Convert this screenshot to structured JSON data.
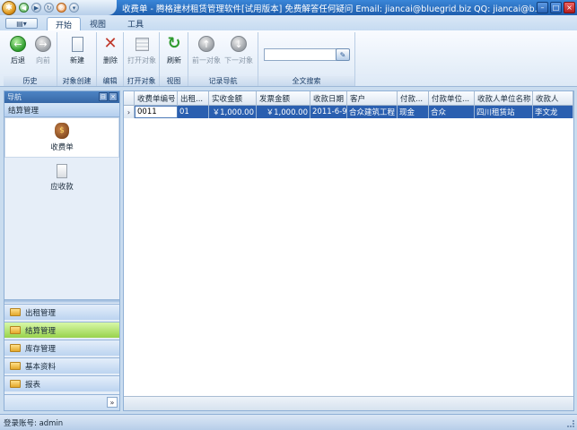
{
  "window": {
    "title": "收费单 - 腾格建材租赁管理软件[试用版本] 免费解答任何疑问 Email: jiancai@bluegrid.biz QQ: jiancai@b...",
    "minimize": "–",
    "maximize": "□",
    "close": "×"
  },
  "quick_access": {
    "orb": "✱",
    "back": "◀",
    "forward": "▶",
    "refresh": "↻",
    "stop": "⊘",
    "more": "▾"
  },
  "app_menu": {
    "label": "▤▾"
  },
  "tabs": [
    {
      "label": "开始",
      "active": true
    },
    {
      "label": "视图",
      "active": false
    },
    {
      "label": "工具",
      "active": false
    }
  ],
  "ribbon": {
    "groups": [
      {
        "label": "历史",
        "buttons": [
          {
            "label": "后退",
            "icon": "←"
          },
          {
            "label": "向前",
            "icon": "→"
          }
        ]
      },
      {
        "label": "对象创建",
        "buttons": [
          {
            "label": "新建"
          }
        ]
      },
      {
        "label": "编辑",
        "buttons": [
          {
            "label": "删除",
            "icon": "✕"
          }
        ]
      },
      {
        "label": "打开对象",
        "buttons": [
          {
            "label": "打开对象"
          }
        ]
      },
      {
        "label": "视图",
        "buttons": [
          {
            "label": "刷新",
            "icon": "↻"
          }
        ]
      },
      {
        "label": "记录导航",
        "buttons": [
          {
            "label": "前一对象",
            "icon": "↑"
          },
          {
            "label": "下一对象",
            "icon": "↓"
          }
        ]
      },
      {
        "label": "全文搜索",
        "search_value": "",
        "search_icon": "✎"
      }
    ]
  },
  "nav": {
    "header": "导航",
    "pin": "⊟",
    "close": "×",
    "section": "结算管理",
    "items": [
      {
        "label": "收费单",
        "icon": "$",
        "selected": true
      },
      {
        "label": "应收款",
        "selected": false
      }
    ],
    "buttons": [
      {
        "label": "出租管理",
        "active": false
      },
      {
        "label": "结算管理",
        "active": true
      },
      {
        "label": "库存管理",
        "active": false
      },
      {
        "label": "基本资料",
        "active": false
      },
      {
        "label": "报表",
        "active": false
      }
    ],
    "chevron": "»"
  },
  "grid": {
    "columns": [
      "收费单编号",
      "出租...",
      "实收金额",
      "发票金额",
      "收款日期",
      "客户",
      "付款...",
      "付款单位...",
      "收款人单位名称",
      "收款人"
    ],
    "row_indicator": "›",
    "rows": [
      [
        "0011",
        "01",
        "￥1,000.00",
        "￥1,000.00",
        "2011-6-9",
        "合众建筑工程",
        "现金",
        "合众",
        "四川租赁站",
        "李文龙"
      ]
    ]
  },
  "status": {
    "text": "登录账号: admin"
  }
}
